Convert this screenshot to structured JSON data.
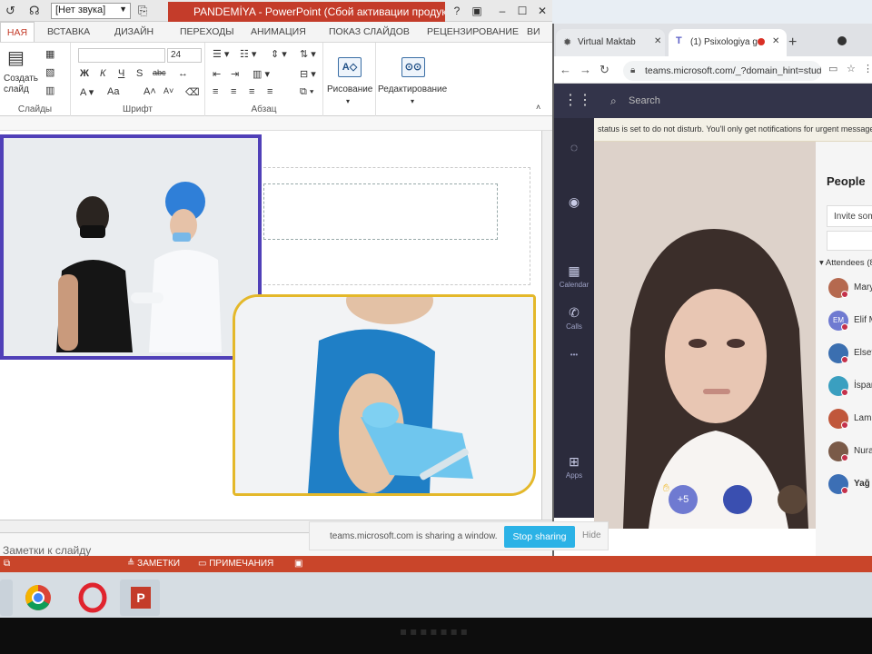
{
  "ppt": {
    "title_app": "PANDEMİYA - PowerPoint (Сбой активации продукта)",
    "sound_select": "[Нет звука]",
    "help_btn": "?",
    "tabs": {
      "home": "НАЯ",
      "insert": "ВСТАВКА",
      "design": "ДИЗАЙН",
      "transitions": "ПЕРЕХОДЫ",
      "animation": "АНИМАЦИЯ",
      "slideshow": "ПОКАЗ СЛАЙДОВ",
      "review": "РЕЦЕНЗИРОВАНИЕ",
      "view": "ВИ"
    },
    "ribbon": {
      "create_slide": "Создать слайд",
      "slides_group": "Слайды",
      "font_size": "24",
      "font_group": "Шрифт",
      "para_group": "Абзац",
      "drawing": "Рисование",
      "editing": "Редактирование",
      "bold": "Ж",
      "italic": "К",
      "underline": "Ч",
      "strike": "S",
      "abc": "abc",
      "aa": "Aa"
    },
    "notes_placeholder": "Заметки к слайду",
    "status": {
      "notes": "ЗАМЕТКИ",
      "comments": "ПРИМЕЧАНИЯ"
    }
  },
  "browser": {
    "tab1": "Virtual Maktab",
    "tab2": "(1) Psixologiya g",
    "url": "teams.microsoft.com/_?domain_hint=stude...",
    "teams_search": "Search",
    "rail": {
      "calendar": "Calendar",
      "calls": "Calls",
      "apps": "Apps",
      "more": "•••"
    },
    "dnd_banner": "status is set to do not disturb. You'll only get notifications for urgent messages and",
    "overflow_count": "+5",
    "people": {
      "title": "People",
      "invite": "Invite som",
      "attendees_label": "Attendees (8",
      "list": [
        {
          "name": "Mary",
          "initials": "",
          "color": "#b5694f"
        },
        {
          "name": "Elif M",
          "initials": "EM",
          "color": "#6f7ad1"
        },
        {
          "name": "Elsev",
          "initials": "",
          "color": "#3b6fb0"
        },
        {
          "name": "İspar",
          "initials": "",
          "color": "#3a9fc0"
        },
        {
          "name": "Lama",
          "initials": "",
          "color": "#c0573b"
        },
        {
          "name": "Nura",
          "initials": "",
          "color": "#7a5a48"
        },
        {
          "name": "Yağ",
          "initials": "",
          "color": "#3c6fb5"
        }
      ]
    }
  },
  "share": {
    "text": "teams.microsoft.com is sharing a window.",
    "stop": "Stop sharing",
    "hide": "Hide"
  },
  "taskbar": {
    "chrome": "chrome-icon",
    "opera": "opera-icon",
    "powerpoint": "P"
  }
}
